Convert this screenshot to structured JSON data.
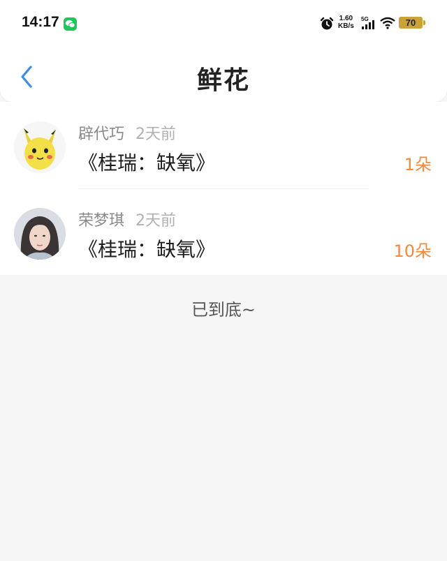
{
  "status_bar": {
    "time": "14:17",
    "net_speed_value": "1.60",
    "net_speed_unit": "KB/s",
    "network": "5G",
    "battery": "70"
  },
  "header": {
    "title": "鲜花"
  },
  "records": [
    {
      "name": "辟代巧",
      "time": "2天前",
      "title": "《桂瑞：缺氧》",
      "quantity": "1朵",
      "avatar_icon": "pikachu-avatar"
    },
    {
      "name": "荣梦琪",
      "time": "2天前",
      "title": "《桂瑞：缺氧》",
      "quantity": "10朵",
      "avatar_icon": "photo-avatar"
    }
  ],
  "footer": {
    "end_text": "已到底~"
  },
  "colors": {
    "accent_back": "#3a8ee6",
    "quantity": "#f08a3c",
    "background": "#f7f6f7"
  }
}
